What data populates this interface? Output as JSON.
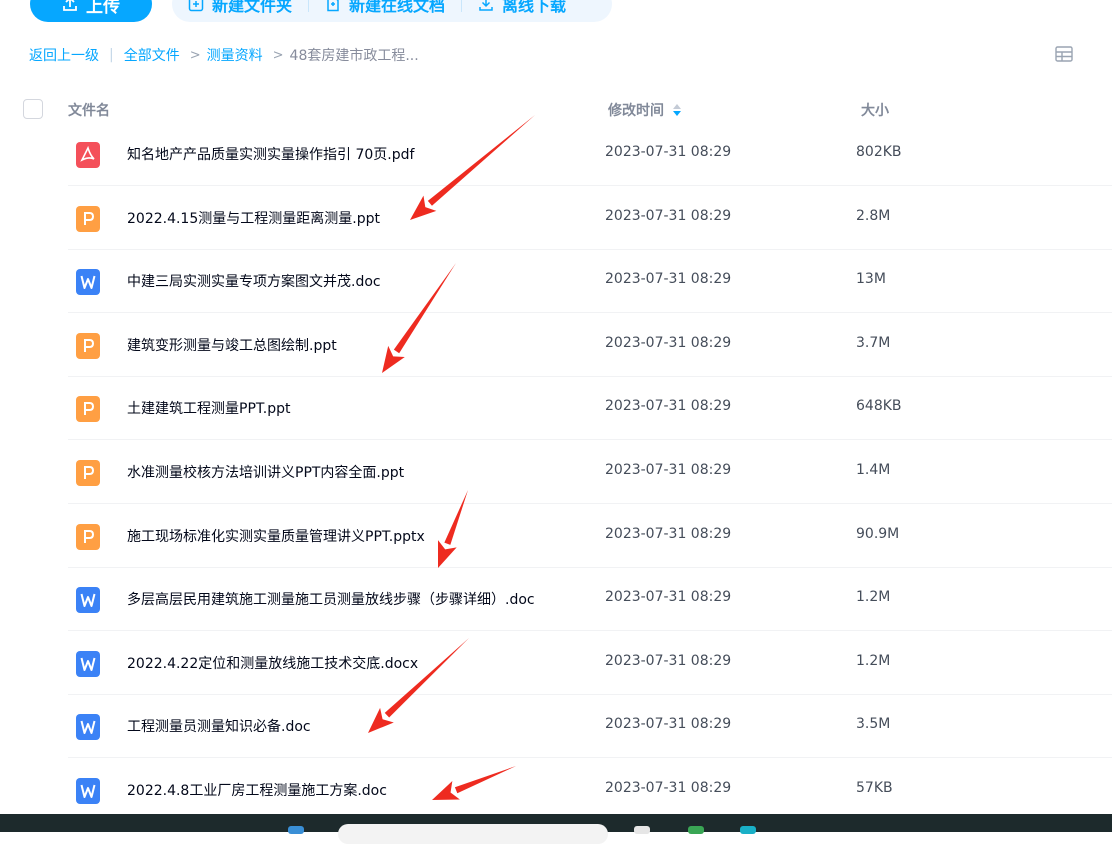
{
  "toolbar": {
    "upload_label": "上传",
    "new_folder_label": "新建文件夹",
    "new_online_doc_label": "新建在线文档",
    "offline_download_label": "离线下载"
  },
  "breadcrumb": {
    "back": "返回上一级",
    "all_files": "全部文件",
    "folder1": "测量资料",
    "current": "48套房建市政工程..."
  },
  "table": {
    "headers": {
      "name": "文件名",
      "modified": "修改时间",
      "size": "大小"
    },
    "rows": [
      {
        "icon": "pdf-icon",
        "name": "知名地产产品质量实测实量操作指引 70页.pdf",
        "modified": "2023-07-31 08:29",
        "size": "802KB"
      },
      {
        "icon": "ppt-icon",
        "name": "2022.4.15测量与工程测量距离测量.ppt",
        "modified": "2023-07-31 08:29",
        "size": "2.8M"
      },
      {
        "icon": "word-icon",
        "name": "中建三局实测实量专项方案图文并茂.doc",
        "modified": "2023-07-31 08:29",
        "size": "13M"
      },
      {
        "icon": "ppt-icon",
        "name": "建筑变形测量与竣工总图绘制.ppt",
        "modified": "2023-07-31 08:29",
        "size": "3.7M"
      },
      {
        "icon": "ppt-icon",
        "name": "土建建筑工程测量PPT.ppt",
        "modified": "2023-07-31 08:29",
        "size": "648KB"
      },
      {
        "icon": "ppt-icon",
        "name": "水准测量校核方法培训讲义PPT内容全面.ppt",
        "modified": "2023-07-31 08:29",
        "size": "1.4M"
      },
      {
        "icon": "ppt-icon",
        "name": "施工现场标准化实测实量质量管理讲义PPT.pptx",
        "modified": "2023-07-31 08:29",
        "size": "90.9M"
      },
      {
        "icon": "word-icon",
        "name": "多层高层民用建筑施工测量施工员测量放线步骤（步骤详细）.doc",
        "modified": "2023-07-31 08:29",
        "size": "1.2M"
      },
      {
        "icon": "word-icon",
        "name": "2022.4.22定位和测量放线施工技术交底.docx",
        "modified": "2023-07-31 08:29",
        "size": "1.2M"
      },
      {
        "icon": "word-icon",
        "name": "工程测量员测量知识必备.doc",
        "modified": "2023-07-31 08:29",
        "size": "3.5M"
      },
      {
        "icon": "word-icon",
        "name": "2022.4.8工业厂房工程测量施工方案.doc",
        "modified": "2023-07-31 08:29",
        "size": "57KB"
      }
    ]
  },
  "colors": {
    "accent": "#06a7ff",
    "pdf": "#f4505a",
    "ppt": "#ff9f43",
    "word": "#3b82f6",
    "annotation_arrow": "#ee2b20"
  }
}
